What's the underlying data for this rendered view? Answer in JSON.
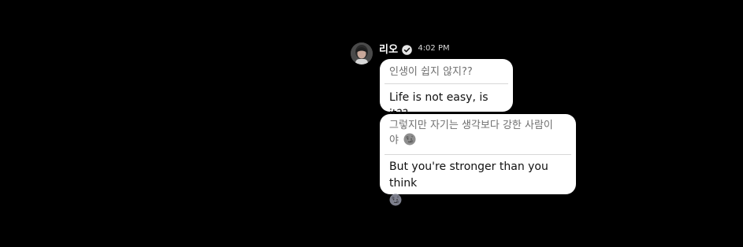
{
  "chat": {
    "sender": {
      "name": "리오",
      "time": "4:02 PM",
      "verified_icon": "verified-check-icon",
      "avatar_icon": "profile-photo"
    },
    "messages": [
      {
        "korean": "인생이 쉽지 않지??",
        "english": "Life is not easy, is it??"
      },
      {
        "korean": "그렇지만 자기는 생각보다 강한 사람이야",
        "korean_line1": "그렇지만 자기는 생각보다 강한 사람이",
        "korean_line2": "야",
        "english": "But you're stronger than you think",
        "emoji": "new-moon-face-icon"
      }
    ]
  },
  "colors": {
    "background": "#000000",
    "bubble": "#ffffff",
    "korean_text": "#6f6f6f",
    "english_text": "#111111",
    "timestamp": "#d9d9d9"
  }
}
